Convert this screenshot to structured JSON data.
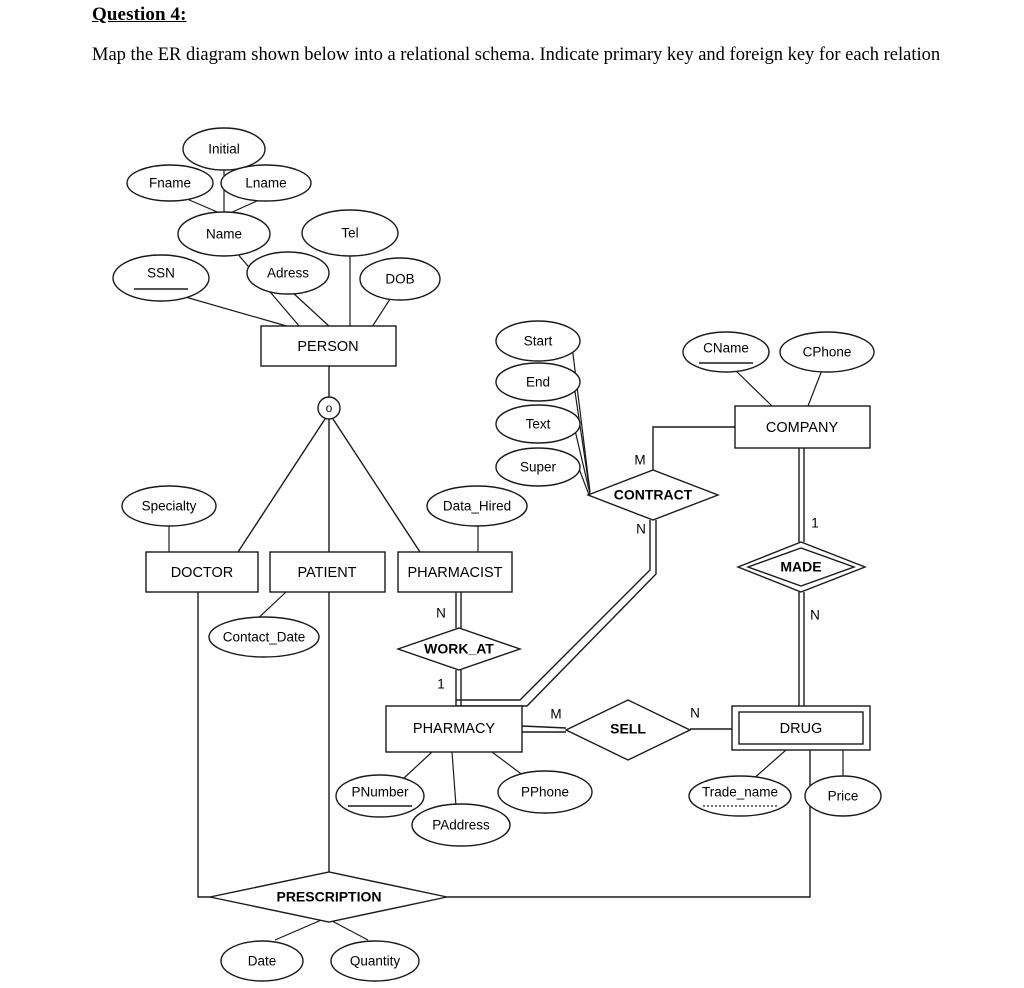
{
  "question": {
    "heading": "Question 4:",
    "prompt": "Map the ER diagram shown below into a relational schema. Indicate primary key and foreign key for each relation"
  },
  "diagram": {
    "type": "er-diagram",
    "entities": {
      "person": {
        "label": "PERSON",
        "kind": "strong"
      },
      "doctor": {
        "label": "DOCTOR",
        "kind": "subclass"
      },
      "patient": {
        "label": "PATIENT",
        "kind": "subclass"
      },
      "pharmacist": {
        "label": "PHARMACIST",
        "kind": "subclass"
      },
      "company": {
        "label": "COMPANY",
        "kind": "strong"
      },
      "pharmacy": {
        "label": "PHARMACY",
        "kind": "strong"
      },
      "drug": {
        "label": "DRUG",
        "kind": "weak"
      }
    },
    "relationships": {
      "contract": {
        "label": "CONTRACT",
        "kind": "regular"
      },
      "made": {
        "label": "MADE",
        "kind": "identifying"
      },
      "work_at": {
        "label": "WORK_AT",
        "kind": "regular"
      },
      "sell": {
        "label": "SELL",
        "kind": "regular"
      },
      "prescription": {
        "label": "PRESCRIPTION",
        "kind": "regular"
      }
    },
    "attributes": {
      "ssn": {
        "label": "SSN",
        "key": "primary"
      },
      "name": {
        "label": "Name",
        "key": "composite"
      },
      "fname": {
        "label": "Fname",
        "key": "none"
      },
      "initial": {
        "label": "Initial",
        "key": "none"
      },
      "lname": {
        "label": "Lname",
        "key": "none"
      },
      "adress": {
        "label": "Adress",
        "key": "none"
      },
      "tel": {
        "label": "Tel",
        "key": "none"
      },
      "dob": {
        "label": "DOB",
        "key": "none"
      },
      "specialty": {
        "label": "Specialty",
        "key": "none"
      },
      "contact_date": {
        "label": "Contact_Date",
        "key": "none"
      },
      "data_hired": {
        "label": "Data_Hired",
        "key": "none"
      },
      "start": {
        "label": "Start",
        "key": "none"
      },
      "end": {
        "label": "End",
        "key": "none"
      },
      "text": {
        "label": "Text",
        "key": "none"
      },
      "super": {
        "label": "Super",
        "key": "none"
      },
      "cname": {
        "label": "CName",
        "key": "primary"
      },
      "cphone": {
        "label": "CPhone",
        "key": "none"
      },
      "pnumber": {
        "label": "PNumber",
        "key": "primary"
      },
      "paddress": {
        "label": "PAddress",
        "key": "none"
      },
      "pphone": {
        "label": "PPhone",
        "key": "none"
      },
      "trade_name": {
        "label": "Trade_name",
        "key": "partial"
      },
      "price": {
        "label": "Price",
        "key": "none"
      },
      "date": {
        "label": "Date",
        "key": "none"
      },
      "quantity": {
        "label": "Quantity",
        "key": "none"
      }
    },
    "specialization": {
      "symbol": "o",
      "meaning": "overlapping"
    },
    "cardinalities": {
      "contract_company": "M",
      "contract_pharmacist": "N",
      "made_company": "1",
      "made_drug": "N",
      "work_at_pharmacist": "N",
      "work_at_pharmacy": "1",
      "sell_pharmacy": "M",
      "sell_drug": "N"
    }
  }
}
